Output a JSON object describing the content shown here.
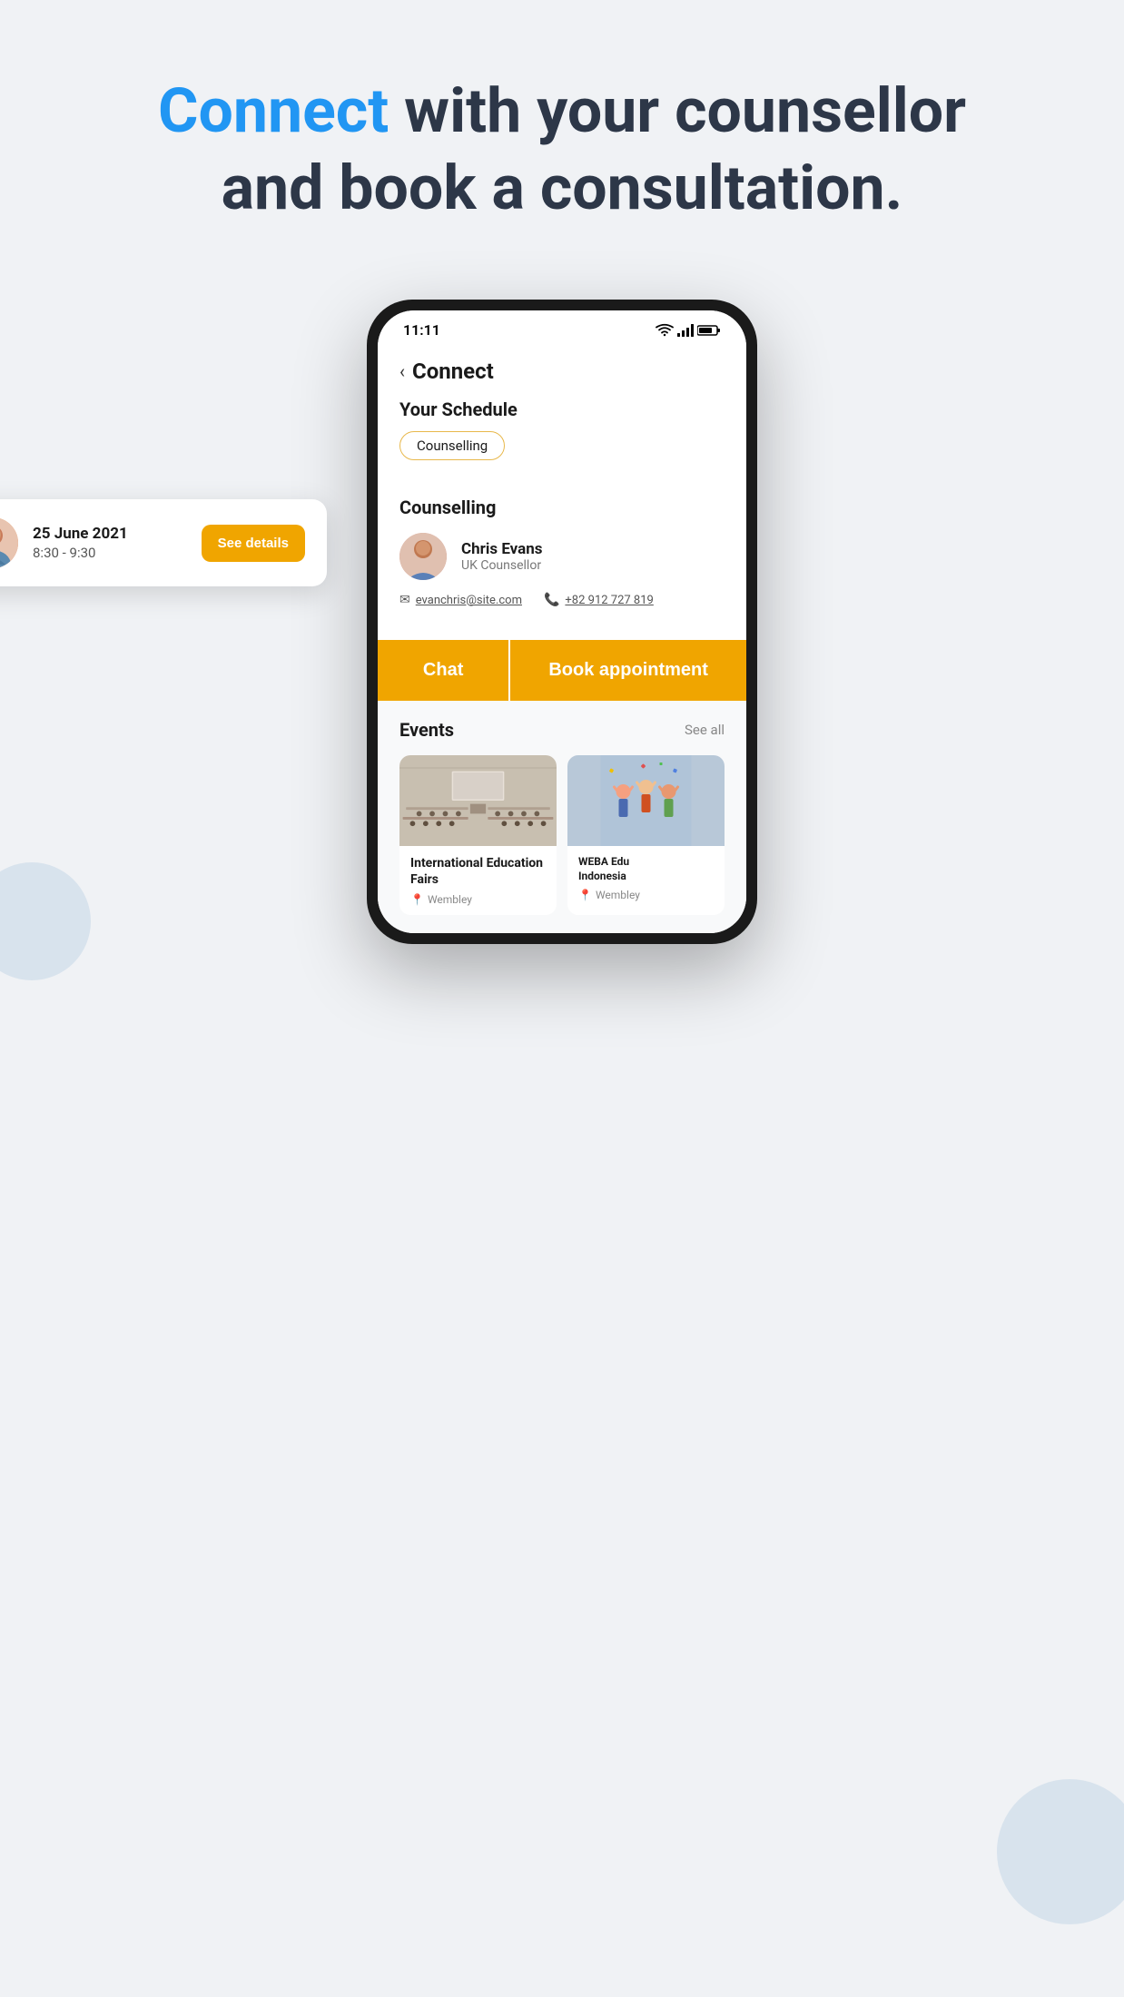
{
  "page": {
    "background_color": "#f0f2f5"
  },
  "header": {
    "title_part1": "Connect",
    "title_part2": " with your counsellor",
    "title_line2": "and book a consultation."
  },
  "status_bar": {
    "time": "11:11"
  },
  "app": {
    "back_label": "‹",
    "screen_title": "Connect",
    "your_schedule_label": "Your Schedule",
    "counselling_badge": "Counselling"
  },
  "floating_card": {
    "date": "25 June 2021",
    "time": "8:30 - 9:30",
    "button_label": "See details"
  },
  "counselling_section": {
    "section_title": "Counselling",
    "counsellor_name": "Chris Evans",
    "counsellor_role": "UK Counsellor",
    "email": "evanchris@site.com",
    "phone": "+82 912 727 819"
  },
  "action_buttons": {
    "chat_label": "Chat",
    "book_label": "Book appointment"
  },
  "events_section": {
    "title": "Events",
    "see_all": "See all",
    "event1_name": "International Education Fairs",
    "event1_location": "Wembley",
    "event2_name": "WEBA Edu Indonesia",
    "event2_location": "Wembley"
  }
}
